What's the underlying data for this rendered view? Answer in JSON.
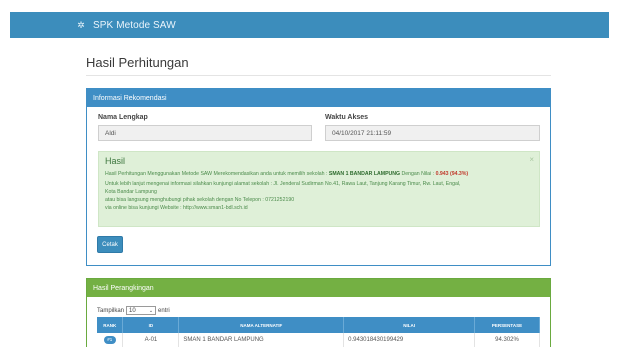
{
  "navbar": {
    "brand": "SPK Metode SAW",
    "logo_icon": "app-logo-icon"
  },
  "page": {
    "title": "Hasil Perhitungan"
  },
  "info_panel": {
    "header": "Informasi Rekomendasi",
    "name_label": "Nama Lengkap",
    "name_value": "Aldi",
    "time_label": "Waktu Akses",
    "time_value": "04/10/2017 21:11:59",
    "alert": {
      "title": "Hasil",
      "close": "×",
      "line1_prefix": "Hasil Perhitungan Menggunakan Metode SAW Merekomendasikan anda untuk memilih sekolah :",
      "line1_school": "SMAN 1 BANDAR LAMPUNG",
      "line1_mid": "Dengan Nilai :",
      "line1_score": "0.943 (94.3%)",
      "line2": "Untuk lebih lanjut mengenai informasi silahkan kunjungi alamat sekolah : Jl. Jenderal Sudirman No.41, Rawa Laut, Tanjung Karang Timur, Rw. Laut, Engal,",
      "line3": "Kota Bandar Lampung",
      "line4": "atau bisa langsung menghubungi pihak sekolah dengan No Telepon : 0721252190",
      "line5": "via online bisa kunjungi Website : http://www.sman1-bdl.sch.id"
    },
    "print_button": "Cetak"
  },
  "rank_panel": {
    "header": "Hasil Perangkingan",
    "show_label": "Tampilkan",
    "entries_value": "10",
    "entries_suffix": "entri",
    "columns": [
      "RANK",
      "ID",
      "NAMA ALTERNATIF",
      "NILAI",
      "PERSENTASE"
    ],
    "rows": [
      {
        "rank": "#1",
        "id": "A-01",
        "name": "SMAN 1 BANDAR LAMPUNG",
        "value": "0.943018430199429",
        "percent": "94.302%"
      }
    ]
  }
}
